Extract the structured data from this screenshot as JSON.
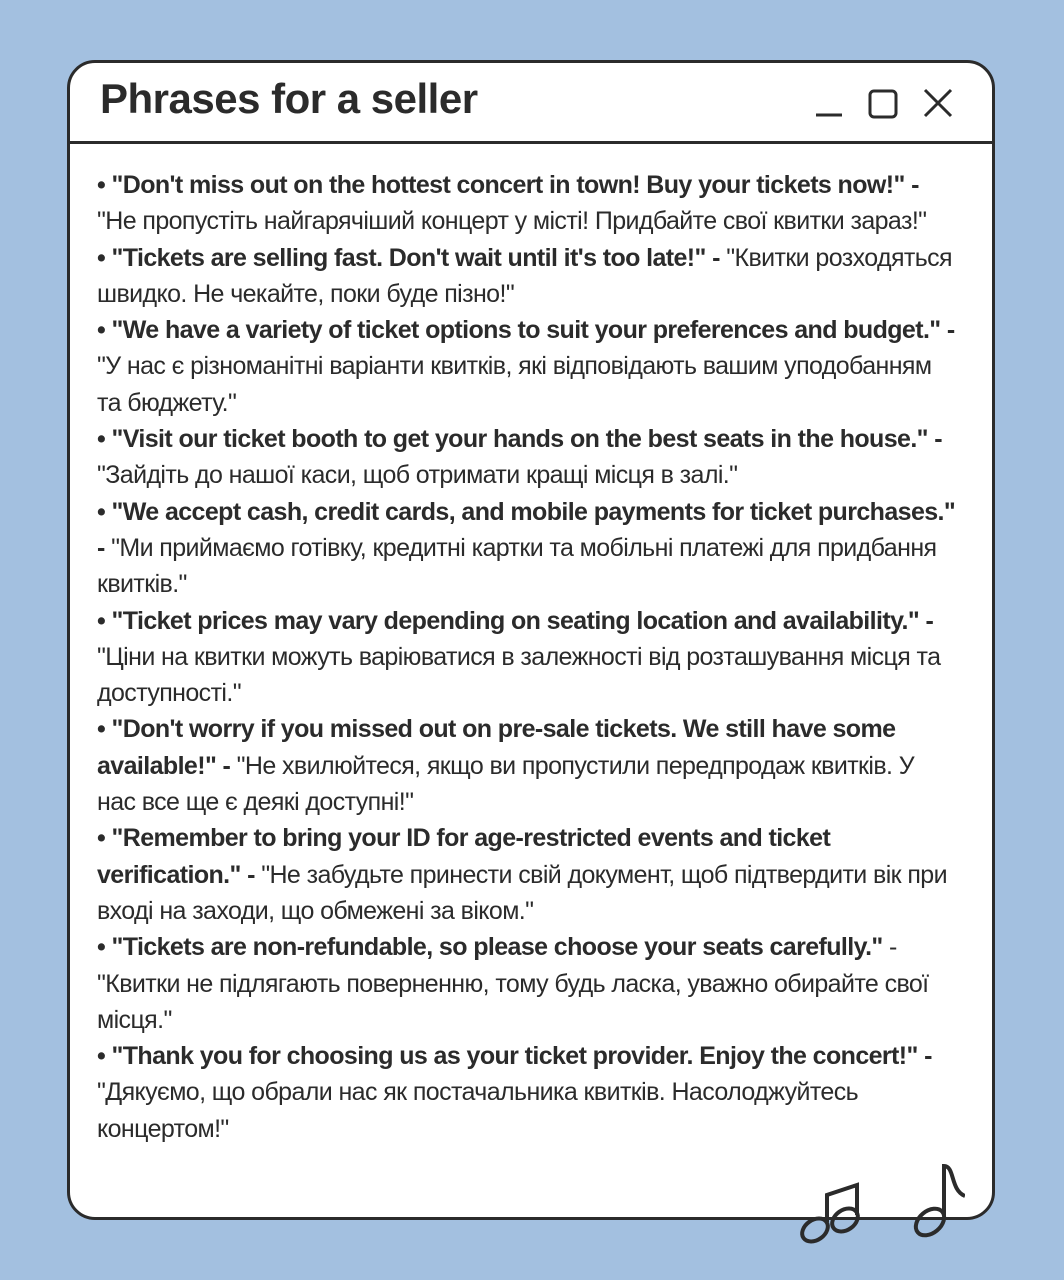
{
  "window": {
    "title": "Phrases for a seller",
    "controls": [
      "minimize-icon",
      "maximize-icon",
      "close-icon"
    ]
  },
  "phrases": [
    {
      "en": "• \"Don't miss out on the hottest concert in town! Buy your tickets now!\" -",
      "uk": " \"Не пропустіть найгарячіший концерт у місті! Придбайте свої квитки зараз!\""
    },
    {
      "en": "• \"Tickets are selling fast. Don't wait until it's too late!\" -",
      "uk": " \"Квитки розходяться швидко. Не чекайте, поки буде пізно!\""
    },
    {
      "en": "• \"We have a variety of ticket options to suit your preferences and budget.\" -",
      "uk": " \"У нас є різноманітні варіанти квитків, які відповідають вашим уподобанням та бюджету.\""
    },
    {
      "en": "• \"Visit our ticket booth to get your hands on the best seats in the house.\" -",
      "uk": " \"Зайдіть до нашої каси, щоб отримати кращі місця в залі.\""
    },
    {
      "en": "• \"We accept cash, credit cards, and mobile payments for ticket purchases.\" -",
      "uk": " \"Ми приймаємо готівку, кредитні картки та мобільні платежі для придбання квитків.\""
    },
    {
      "en": "• \"Ticket prices may vary depending on seating location and availability.\" -",
      "uk": " \"Ціни на квитки можуть варіюватися в залежності від розташування місця та доступності.\""
    },
    {
      "en": "• \"Don't worry if you missed out on pre-sale tickets. We still have some available!\" -",
      "uk": " \"Не хвилюйтеся, якщо ви пропустили передпродаж квитків. У нас все ще є деякі доступні!\""
    },
    {
      "en": "• \"Remember to bring your ID for age-restricted events and ticket verification.\" -",
      "uk": " \"Не забудьте принести свій документ, щоб підтвердити вік при вході на заходи, що обмежені за віком.\""
    },
    {
      "en": "• \"Tickets are non-refundable, so please choose your seats carefully.\"",
      "uk": " - \"Квитки не підлягають поверненню, тому будь ласка, уважно обирайте свої місця.\""
    },
    {
      "en": "• \"Thank you for choosing us as your ticket provider. Enjoy the concert!\" -",
      "uk": " \"Дякуємо, що обрали нас як постачальника квитків. Насолоджуйтесь концертом!\""
    }
  ],
  "colors": {
    "background": "#a3c0e0",
    "ink": "#2b2b2b",
    "window": "#ffffff"
  }
}
